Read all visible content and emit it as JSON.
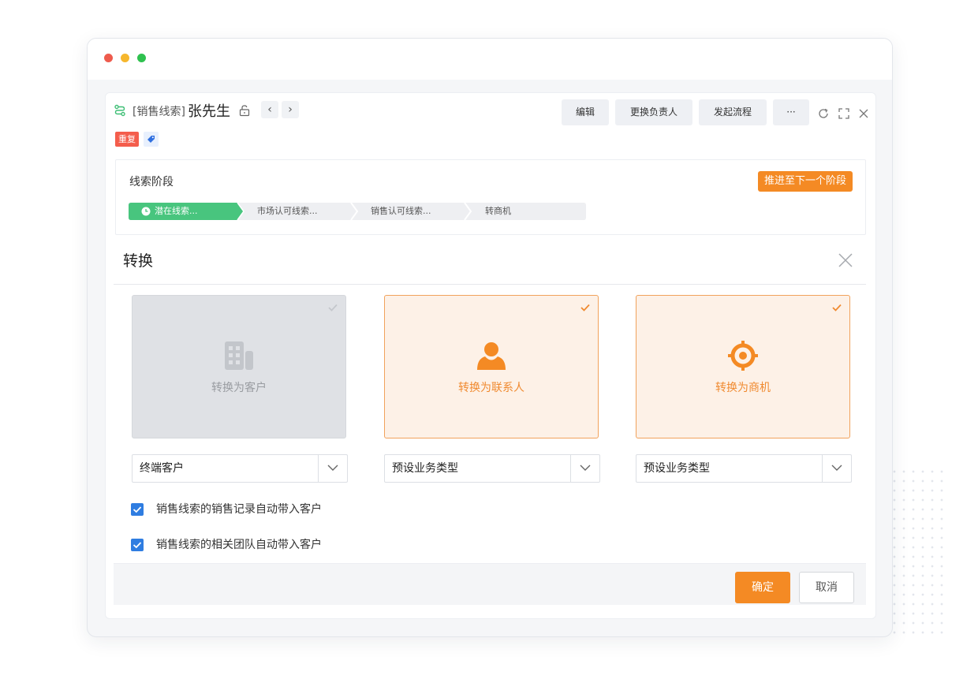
{
  "header": {
    "record_type": "[销售线索]",
    "record_name": "张先生",
    "tags": {
      "duplicate": "重复"
    },
    "actions": {
      "edit": "编辑",
      "change_owner": "更换负责人",
      "start_flow": "发起流程",
      "more": "···"
    }
  },
  "stage": {
    "title": "线索阶段",
    "advance_label": "推进至下一个阶段",
    "steps": [
      {
        "label": "潜在线索...",
        "status": "current"
      },
      {
        "label": "市场认可线索...",
        "status": "pending"
      },
      {
        "label": "销售认可线索...",
        "status": "pending"
      },
      {
        "label": "转商机",
        "status": "pending"
      }
    ]
  },
  "convert": {
    "title": "转换",
    "cards": [
      {
        "label": "转换为客户",
        "icon": "building-icon",
        "state": "disabled"
      },
      {
        "label": "转换为联系人",
        "icon": "contact-icon",
        "state": "selected"
      },
      {
        "label": "转换为商机",
        "icon": "target-icon",
        "state": "selected"
      }
    ],
    "selects": [
      {
        "value": "终端客户"
      },
      {
        "value": "预设业务类型"
      },
      {
        "value": "预设业务类型"
      }
    ],
    "checkboxes": [
      {
        "label": "销售线索的销售记录自动带入客户",
        "checked": true
      },
      {
        "label": "销售线索的相关团队自动带入客户",
        "checked": true
      }
    ],
    "confirm_label": "确定",
    "cancel_label": "取消"
  },
  "colors": {
    "accent": "#f48a24",
    "stage_active": "#48c57e",
    "checkbox": "#2f7de1",
    "danger_tag": "#f45d4c"
  }
}
